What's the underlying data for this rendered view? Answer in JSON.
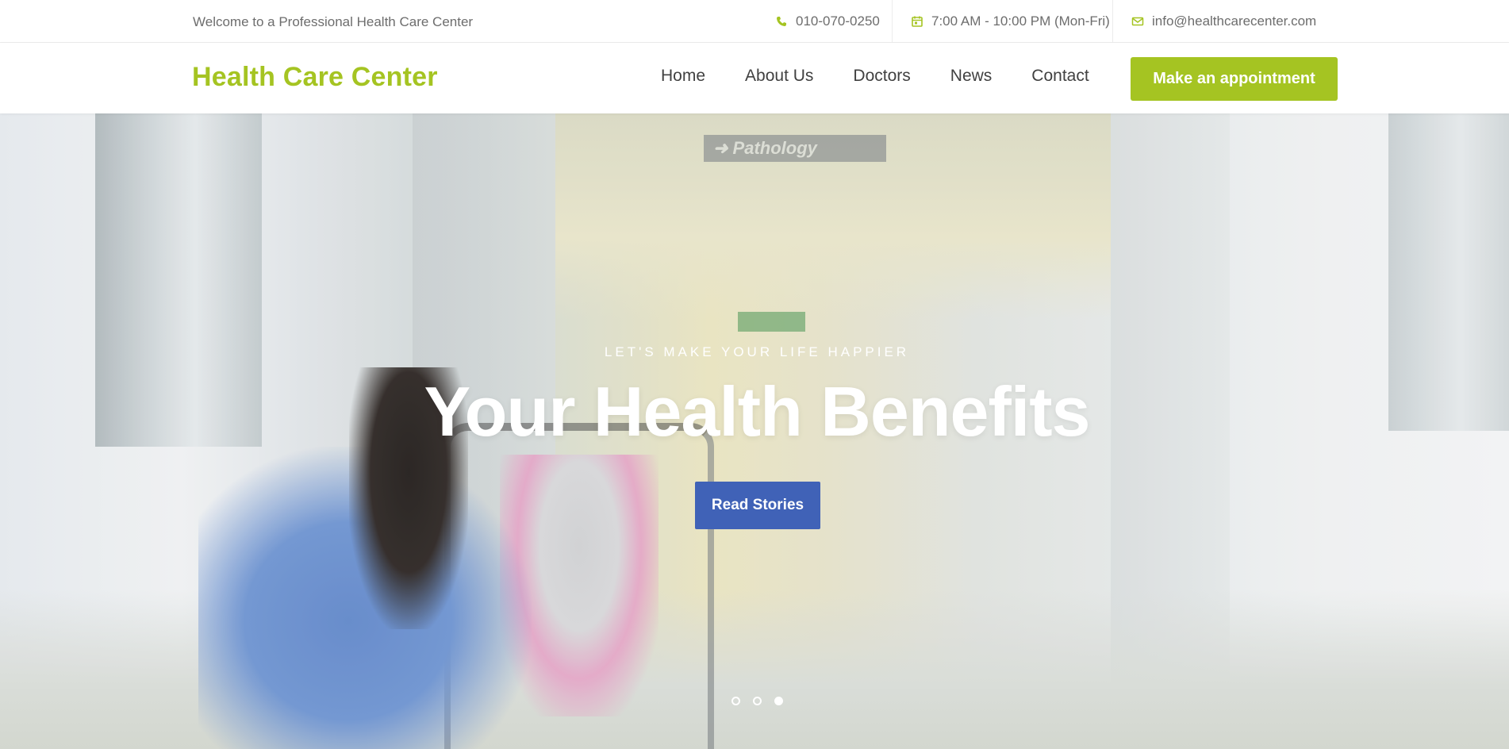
{
  "topbar": {
    "welcome": "Welcome to a Professional Health Care Center",
    "phone": "010-070-0250",
    "hours": "7:00 AM - 10:00 PM (Mon-Fri)",
    "email": "info@healthcarecenter.com",
    "icons": [
      "phone-icon",
      "calendar-icon",
      "envelope-icon"
    ]
  },
  "nav": {
    "logo": "Health Care Center",
    "items": [
      "Home",
      "About Us",
      "Doctors",
      "News",
      "Contact"
    ],
    "appointment": "Make an appointment"
  },
  "hero": {
    "eyebrow": "LET'S MAKE YOUR LIFE HAPPIER",
    "headline": "Your Health Benefits",
    "cta": "Read Stories",
    "slides": 3,
    "active_slide": 3,
    "sign_text": "Pathology"
  },
  "colors": {
    "brand_green": "#a5c422",
    "cta_blue": "#4062b7",
    "text_grey": "#6d6d6d",
    "nav_text": "#414141"
  }
}
